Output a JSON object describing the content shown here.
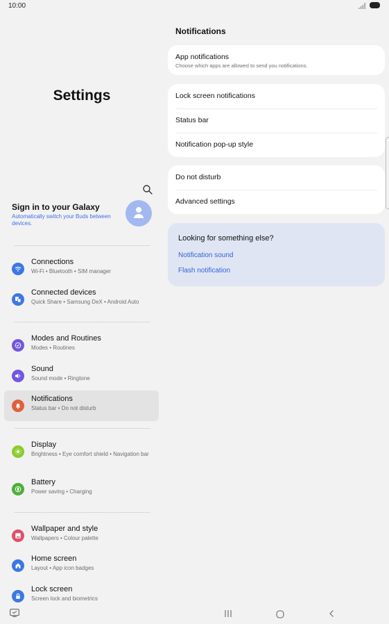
{
  "status": {
    "time": "10:00"
  },
  "left": {
    "title": "Settings",
    "account": {
      "title": "Sign in to your Galaxy",
      "subtitle": "Automatically switch your Buds between devices."
    },
    "items": [
      {
        "title": "Connections",
        "sub": "Wi-Fi  •  Bluetooth  •  SIM manager",
        "icon": "wifi-icon",
        "color": "#3e77e3"
      },
      {
        "title": "Connected devices",
        "sub": "Quick Share  •  Samsung DeX  •  Android Auto",
        "icon": "connected-devices-icon",
        "color": "#3e77e3"
      },
      {
        "title": "Modes and Routines",
        "sub": "Modes  •  Routines",
        "icon": "modes-icon",
        "color": "#7356e0"
      },
      {
        "title": "Sound",
        "sub": "Sound mode  •  Ringtone",
        "icon": "sound-icon",
        "color": "#7356e0"
      },
      {
        "title": "Notifications",
        "sub": "Status bar  •  Do not disturb",
        "icon": "bell-icon",
        "color": "#e0603e"
      },
      {
        "title": "Display",
        "sub": "Brightness  •  Eye comfort shield  •  Navigation bar",
        "icon": "sun-icon",
        "color": "#8ccb2e"
      },
      {
        "title": "Battery",
        "sub": "Power saving  •  Charging",
        "icon": "battery-icon",
        "color": "#4caf3b"
      },
      {
        "title": "Wallpaper and style",
        "sub": "Wallpapers  •  Colour palette",
        "icon": "wallpaper-icon",
        "color": "#e0506b"
      },
      {
        "title": "Home screen",
        "sub": "Layout  •  App icon badges",
        "icon": "home-icon",
        "color": "#3e77e3"
      },
      {
        "title": "Lock screen",
        "sub": "Screen lock and biometrics",
        "icon": "lock-icon",
        "color": "#3e77e3"
      }
    ]
  },
  "right": {
    "title": "Notifications",
    "app_notifications": {
      "label": "App notifications",
      "desc": "Choose which apps are allowed to send you notifications."
    },
    "group2": [
      "Lock screen notifications",
      "Status bar",
      "Notification pop-up style"
    ],
    "group3": [
      "Do not disturb",
      "Advanced settings"
    ],
    "suggest": {
      "heading": "Looking for something else?",
      "links": [
        "Notification sound",
        "Flash notification"
      ]
    }
  },
  "colors": {
    "accent": "#3463d6",
    "active_item": "#e3e3e3",
    "suggest_bg": "#dfe5f3"
  }
}
